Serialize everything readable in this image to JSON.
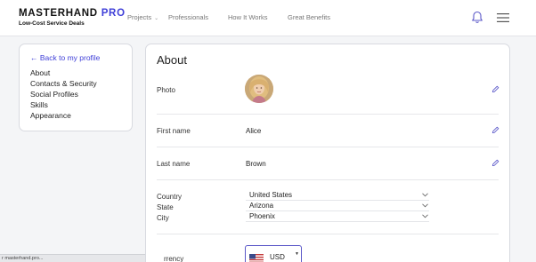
{
  "brand": {
    "name": "MASTERHAND",
    "name_suffix": "PRO",
    "tagline": "Low-Cost Service Deals",
    "accent_color": "#3f3fd8"
  },
  "nav": {
    "items": [
      {
        "label": "Projects",
        "has_dropdown": true
      },
      {
        "label": "Professionals"
      },
      {
        "label": "How It Works"
      },
      {
        "label": "Great Benefits"
      }
    ],
    "icons": [
      "bell-icon",
      "menu-icon"
    ]
  },
  "sidebar": {
    "back_label": "← Back to my profile",
    "items": [
      {
        "label": "About"
      },
      {
        "label": "Contacts & Security"
      },
      {
        "label": "Social Profiles"
      },
      {
        "label": "Skills"
      },
      {
        "label": "Appearance"
      }
    ]
  },
  "about": {
    "title": "About",
    "photo_label": "Photo",
    "first_name_label": "First name",
    "first_name": "Alice",
    "last_name_label": "Last name",
    "last_name": "Brown",
    "country_label": "Country",
    "country": "United States",
    "state_label": "State",
    "state": "Arizona",
    "city_label": "City",
    "city": "Phoenix",
    "currency_label": "rrency",
    "currency": "USD"
  },
  "status_bar": {
    "text": "r masterhand.pro..."
  }
}
